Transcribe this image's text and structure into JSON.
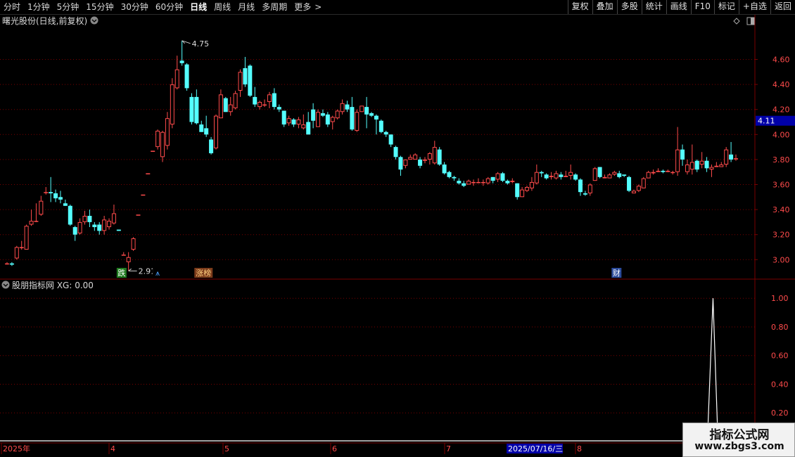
{
  "toolbar": {
    "periods": [
      "分时",
      "1分钟",
      "5分钟",
      "15分钟",
      "30分钟",
      "60分钟",
      "日线",
      "周线",
      "月线",
      "多周期",
      "更多"
    ],
    "active_period": "日线",
    "more_arrow": ">",
    "right_buttons": [
      "复权",
      "叠加",
      "多股",
      "统计",
      "画线",
      "F10",
      "标记",
      "+自选",
      "返回"
    ]
  },
  "main_panel": {
    "title": "曙光股份(日线,前复权)",
    "current_price_label": "4.11",
    "high_label": "4.75",
    "low_label": "2.91",
    "event_markers": [
      {
        "text": "跌",
        "bg": "#1e7a1e",
        "color": "#ffffff"
      },
      {
        "text": "⩚",
        "bg": "#000000",
        "color": "#4aa0ff"
      },
      {
        "text": "涨榜",
        "bg": "#7a3a1a",
        "color": "#ffd080"
      },
      {
        "text": "财",
        "bg": "#2a4a9a",
        "color": "#ffffff"
      }
    ],
    "y_ticks": [
      "4.60",
      "4.40",
      "4.20",
      "4.00",
      "3.80",
      "3.60",
      "3.40",
      "3.20",
      "3.00"
    ]
  },
  "sub_panel": {
    "title": "股朋指标网 XG: 0.00",
    "y_ticks": [
      "1.00",
      "0.80",
      "0.60",
      "0.40",
      "0.20"
    ]
  },
  "x_axis": {
    "labels": [
      "2025年",
      "4",
      "5",
      "6",
      "7",
      "8"
    ],
    "cursor_date": "2025/07/16/三"
  },
  "colors": {
    "up": "#ff4b4b",
    "down": "#54ffff",
    "grid": "#7a0000",
    "axis_text": "#ff4b4b",
    "price_box": "#0000a8",
    "indicator_line": "#ffffff"
  },
  "chart_data": {
    "type": "candlestick",
    "title": "曙光股份(日线,前复权)",
    "ylim": [
      2.85,
      4.85
    ],
    "candles": [
      [
        2.97,
        2.97,
        2.98,
        2.96
      ],
      [
        2.97,
        2.96,
        2.98,
        2.95
      ],
      [
        3.01,
        3.1,
        3.11,
        3.0
      ],
      [
        3.1,
        3.1,
        3.15,
        3.08
      ],
      [
        3.08,
        3.27,
        3.28,
        3.08
      ],
      [
        3.28,
        3.31,
        3.4,
        3.27
      ],
      [
        3.31,
        3.31,
        3.45,
        3.3
      ],
      [
        3.36,
        3.47,
        3.51,
        3.35
      ],
      [
        3.54,
        3.54,
        3.58,
        3.52
      ],
      [
        3.54,
        3.53,
        3.66,
        3.46
      ],
      [
        3.53,
        3.49,
        3.56,
        3.46
      ],
      [
        3.5,
        3.48,
        3.55,
        3.45
      ],
      [
        3.45,
        3.43,
        3.48,
        3.43
      ],
      [
        3.43,
        3.28,
        3.44,
        3.27
      ],
      [
        3.26,
        3.2,
        3.27,
        3.15
      ],
      [
        3.21,
        3.3,
        3.33,
        3.2
      ],
      [
        3.3,
        3.35,
        3.39,
        3.28
      ],
      [
        3.35,
        3.3,
        3.4,
        3.26
      ],
      [
        3.28,
        3.26,
        3.3,
        3.23
      ],
      [
        3.28,
        3.23,
        3.3,
        3.2
      ],
      [
        3.23,
        3.32,
        3.35,
        3.2
      ],
      [
        3.26,
        3.31,
        3.33,
        3.24
      ],
      [
        3.29,
        3.37,
        3.44,
        3.28
      ],
      [
        3.24,
        3.23,
        3.24,
        3.23
      ],
      [
        3.04,
        3.04,
        3.06,
        3.04
      ],
      [
        2.98,
        3.02,
        3.06,
        2.91
      ],
      [
        3.08,
        3.17,
        3.18,
        3.07
      ],
      [
        3.36,
        3.36,
        3.36,
        3.36
      ],
      [
        3.52,
        3.52,
        3.52,
        3.52
      ],
      [
        3.69,
        3.69,
        3.69,
        3.69
      ],
      [
        3.87,
        3.87,
        3.87,
        3.87
      ],
      [
        3.9,
        4.03,
        4.04,
        3.88
      ],
      [
        3.82,
        4.02,
        4.03,
        3.78
      ],
      [
        3.91,
        4.13,
        4.18,
        3.88
      ],
      [
        4.08,
        4.4,
        4.45,
        4.05
      ],
      [
        4.37,
        4.52,
        4.63,
        4.36
      ],
      [
        4.59,
        4.57,
        4.75,
        4.55
      ],
      [
        4.56,
        4.37,
        4.57,
        4.35
      ],
      [
        4.3,
        4.1,
        4.33,
        4.08
      ],
      [
        4.3,
        4.09,
        4.36,
        4.08
      ],
      [
        4.08,
        4.02,
        4.11,
        4.02
      ],
      [
        4.05,
        4.0,
        4.15,
        3.98
      ],
      [
        3.96,
        3.85,
        3.98,
        3.84
      ],
      [
        3.89,
        4.15,
        4.16,
        3.88
      ],
      [
        4.13,
        4.32,
        4.36,
        4.13
      ],
      [
        4.29,
        4.18,
        4.3,
        4.18
      ],
      [
        4.18,
        4.24,
        4.3,
        4.15
      ],
      [
        4.21,
        4.33,
        4.35,
        4.2
      ],
      [
        4.35,
        4.5,
        4.52,
        4.3
      ],
      [
        4.53,
        4.4,
        4.62,
        4.38
      ],
      [
        4.55,
        4.31,
        4.56,
        4.3
      ],
      [
        4.3,
        4.24,
        4.38,
        4.22
      ],
      [
        4.22,
        4.26,
        4.27,
        4.2
      ],
      [
        4.24,
        4.24,
        4.28,
        4.22
      ],
      [
        4.26,
        4.32,
        4.34,
        4.21
      ],
      [
        4.33,
        4.22,
        4.37,
        4.2
      ],
      [
        4.22,
        4.2,
        4.24,
        4.18
      ],
      [
        4.19,
        4.08,
        4.19,
        4.06
      ],
      [
        4.09,
        4.13,
        4.15,
        4.07
      ],
      [
        4.12,
        4.08,
        4.13,
        4.06
      ],
      [
        4.08,
        4.12,
        4.14,
        4.05
      ],
      [
        4.05,
        4.08,
        4.16,
        4.04
      ],
      [
        4.1,
        4.0,
        4.18,
        4.0
      ],
      [
        4.2,
        4.11,
        4.25,
        4.05
      ],
      [
        4.06,
        4.18,
        4.2,
        4.06
      ],
      [
        4.17,
        4.15,
        4.2,
        4.14
      ],
      [
        4.16,
        4.08,
        4.18,
        4.06
      ],
      [
        4.1,
        4.14,
        4.15,
        4.04
      ],
      [
        4.13,
        4.19,
        4.2,
        4.12
      ],
      [
        4.18,
        4.25,
        4.28,
        4.16
      ],
      [
        4.24,
        4.2,
        4.27,
        4.18
      ],
      [
        4.22,
        4.04,
        4.3,
        4.03
      ],
      [
        4.03,
        4.18,
        4.2,
        4.02
      ],
      [
        4.18,
        4.23,
        4.23,
        4.18
      ],
      [
        4.22,
        4.16,
        4.3,
        4.05
      ],
      [
        4.17,
        4.15,
        4.18,
        4.14
      ],
      [
        4.15,
        4.12,
        4.16,
        4.0
      ],
      [
        4.11,
        4.02,
        4.12,
        4.01
      ],
      [
        4.02,
        4.0,
        4.03,
        3.98
      ],
      [
        4.0,
        3.92,
        4.0,
        3.9
      ],
      [
        3.9,
        3.82,
        3.91,
        3.8
      ],
      [
        3.82,
        3.72,
        3.83,
        3.67
      ],
      [
        3.75,
        3.8,
        3.8,
        3.73
      ],
      [
        3.8,
        3.82,
        3.84,
        3.8
      ],
      [
        3.8,
        3.84,
        3.85,
        3.82
      ],
      [
        3.8,
        3.75,
        3.82,
        3.73
      ],
      [
        3.79,
        3.8,
        3.82,
        3.77
      ],
      [
        3.8,
        3.85,
        3.86,
        3.76
      ],
      [
        3.77,
        3.9,
        3.95,
        3.76
      ],
      [
        3.88,
        3.76,
        3.9,
        3.75
      ],
      [
        3.76,
        3.69,
        3.78,
        3.68
      ],
      [
        3.7,
        3.66,
        3.71,
        3.65
      ],
      [
        3.66,
        3.65,
        3.67,
        3.63
      ],
      [
        3.63,
        3.61,
        3.65,
        3.6
      ],
      [
        3.61,
        3.59,
        3.63,
        3.58
      ],
      [
        3.6,
        3.63,
        3.64,
        3.6
      ],
      [
        3.62,
        3.62,
        3.64,
        3.59
      ],
      [
        3.62,
        3.62,
        3.65,
        3.61
      ],
      [
        3.62,
        3.62,
        3.64,
        3.59
      ],
      [
        3.61,
        3.65,
        3.66,
        3.6
      ],
      [
        3.66,
        3.63,
        3.66,
        3.61
      ],
      [
        3.64,
        3.69,
        3.7,
        3.62
      ],
      [
        3.69,
        3.63,
        3.7,
        3.62
      ],
      [
        3.63,
        3.61,
        3.64,
        3.6
      ],
      [
        3.62,
        3.63,
        3.65,
        3.61
      ],
      [
        3.61,
        3.5,
        3.61,
        3.48
      ],
      [
        3.5,
        3.56,
        3.58,
        3.5
      ],
      [
        3.55,
        3.58,
        3.59,
        3.54
      ],
      [
        3.57,
        3.62,
        3.66,
        3.55
      ],
      [
        3.61,
        3.7,
        3.76,
        3.6
      ],
      [
        3.7,
        3.69,
        3.71,
        3.66
      ],
      [
        3.68,
        3.65,
        3.69,
        3.64
      ],
      [
        3.66,
        3.67,
        3.7,
        3.64
      ],
      [
        3.65,
        3.69,
        3.71,
        3.64
      ],
      [
        3.68,
        3.66,
        3.7,
        3.64
      ],
      [
        3.66,
        3.67,
        3.71,
        3.66
      ],
      [
        3.67,
        3.7,
        3.76,
        3.64
      ],
      [
        3.68,
        3.64,
        3.69,
        3.63
      ],
      [
        3.64,
        3.54,
        3.65,
        3.51
      ],
      [
        3.53,
        3.52,
        3.55,
        3.51
      ],
      [
        3.53,
        3.6,
        3.61,
        3.51
      ],
      [
        3.63,
        3.73,
        3.74,
        3.63
      ],
      [
        3.74,
        3.66,
        3.74,
        3.65
      ],
      [
        3.65,
        3.66,
        3.68,
        3.65
      ],
      [
        3.65,
        3.68,
        3.69,
        3.65
      ],
      [
        3.68,
        3.7,
        3.71,
        3.67
      ],
      [
        3.69,
        3.66,
        3.71,
        3.65
      ],
      [
        3.68,
        3.67,
        3.68,
        3.66
      ],
      [
        3.66,
        3.55,
        3.67,
        3.54
      ],
      [
        3.53,
        3.55,
        3.56,
        3.53
      ],
      [
        3.55,
        3.59,
        3.6,
        3.54
      ],
      [
        3.57,
        3.65,
        3.66,
        3.57
      ],
      [
        3.65,
        3.7,
        3.71,
        3.65
      ],
      [
        3.69,
        3.7,
        3.72,
        3.68
      ],
      [
        3.7,
        3.71,
        3.73,
        3.7
      ],
      [
        3.71,
        3.7,
        3.72,
        3.69
      ],
      [
        3.7,
        3.71,
        3.72,
        3.7
      ],
      [
        3.7,
        3.7,
        3.71,
        3.68
      ],
      [
        3.7,
        3.88,
        4.06,
        3.67
      ],
      [
        3.88,
        3.8,
        3.92,
        3.75
      ],
      [
        3.7,
        3.76,
        3.8,
        3.68
      ],
      [
        3.72,
        3.78,
        3.92,
        3.68
      ],
      [
        3.79,
        3.72,
        3.8,
        3.7
      ],
      [
        3.76,
        3.79,
        3.86,
        3.73
      ],
      [
        3.79,
        3.73,
        3.82,
        3.7
      ],
      [
        3.72,
        3.74,
        3.76,
        3.66
      ],
      [
        3.74,
        3.75,
        3.78,
        3.74
      ],
      [
        3.74,
        3.76,
        3.78,
        3.74
      ],
      [
        3.76,
        3.88,
        3.9,
        3.74
      ],
      [
        3.84,
        3.8,
        3.94,
        3.78
      ],
      [
        3.81,
        3.81,
        3.84,
        3.79
      ]
    ],
    "high_label": 4.75,
    "low_label": 2.91,
    "current_price": 4.11,
    "indicator": {
      "name": "XG",
      "ylim": [
        0,
        1.05
      ],
      "spike_index": 145,
      "spike_value": 1.0
    }
  }
}
